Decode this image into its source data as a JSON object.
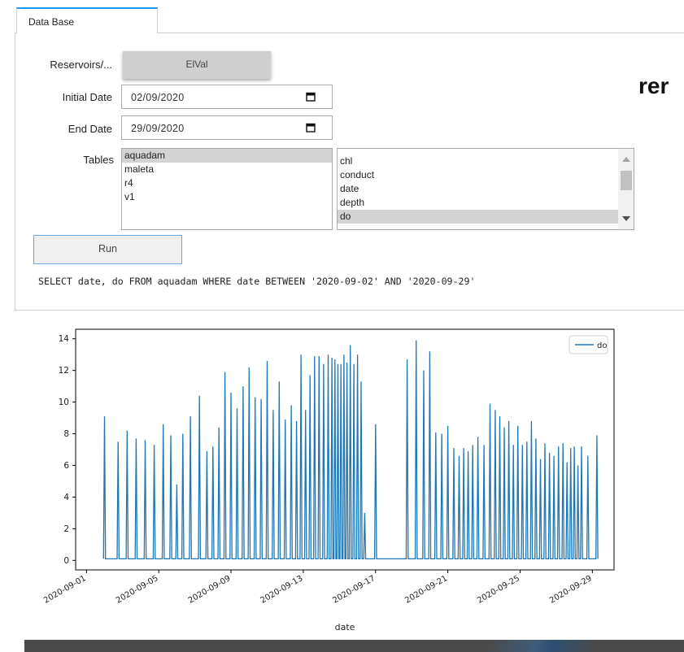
{
  "tab": {
    "label": "Data Base"
  },
  "form": {
    "reservoirs_label": "Reservoirs/...",
    "reservoir_value": "ElVal",
    "initial_date_label": "Initial Date",
    "initial_date_value": "02/09/2020",
    "end_date_label": "End Date",
    "end_date_value": "29/09/2020",
    "tables_label": "Tables",
    "tables": [
      "aquadam",
      "maleta",
      "r4",
      "v1"
    ],
    "tables_selected": "aquadam",
    "columns": [
      "chl",
      "conduct",
      "date",
      "depth",
      "do"
    ],
    "columns_selected": "do",
    "run_label": "Run",
    "sql": "SELECT date, do FROM aquadam WHERE date BETWEEN '2020-09-02' AND '2020-09-29'"
  },
  "overlay_text": "rer",
  "colors": {
    "accent": "#2196f3",
    "series": "#1f77b4"
  },
  "chart_data": {
    "type": "line",
    "title": "",
    "xlabel": "date",
    "ylabel": "",
    "ylim": [
      -0.6,
      14.6
    ],
    "xlim": [
      "2020-09-01",
      "2020-09-30"
    ],
    "yticks": [
      0,
      2,
      4,
      6,
      8,
      10,
      12,
      14
    ],
    "xticks": [
      "2020-09-01",
      "2020-09-05",
      "2020-09-09",
      "2020-09-13",
      "2020-09-17",
      "2020-09-21",
      "2020-09-25",
      "2020-09-29"
    ],
    "legend": "top-right",
    "series": [
      {
        "name": "do",
        "peaks": [
          [
            "2020-09-02",
            9.1
          ],
          [
            "2020-09-03",
            7.5
          ],
          [
            "2020-09-03",
            8.2
          ],
          [
            "2020-09-04",
            7.7
          ],
          [
            "2020-09-04",
            7.6
          ],
          [
            "2020-09-05",
            7.3
          ],
          [
            "2020-09-05",
            8.6
          ],
          [
            "2020-09-06",
            7.9
          ],
          [
            "2020-09-06",
            4.8
          ],
          [
            "2020-09-06",
            8.0
          ],
          [
            "2020-09-07",
            9.1
          ],
          [
            "2020-09-07",
            10.4
          ],
          [
            "2020-09-08",
            6.9
          ],
          [
            "2020-09-08",
            7.2
          ],
          [
            "2020-09-08",
            8.4
          ],
          [
            "2020-09-09",
            11.9
          ],
          [
            "2020-09-09",
            10.6
          ],
          [
            "2020-09-09",
            9.6
          ],
          [
            "2020-09-10",
            11.0
          ],
          [
            "2020-09-10",
            12.2
          ],
          [
            "2020-09-10",
            10.3
          ],
          [
            "2020-09-11",
            10.2
          ],
          [
            "2020-09-11",
            12.6
          ],
          [
            "2020-09-11",
            9.5
          ],
          [
            "2020-09-12",
            11.3
          ],
          [
            "2020-09-12",
            8.9
          ],
          [
            "2020-09-12",
            9.8
          ],
          [
            "2020-09-13",
            8.8
          ],
          [
            "2020-09-13",
            13.0
          ],
          [
            "2020-09-13",
            9.5
          ],
          [
            "2020-09-13",
            11.7
          ],
          [
            "2020-09-14",
            12.9
          ],
          [
            "2020-09-14",
            12.9
          ],
          [
            "2020-09-14",
            12.4
          ],
          [
            "2020-09-14",
            13.0
          ],
          [
            "2020-09-15",
            12.8
          ],
          [
            "2020-09-15",
            12.7
          ],
          [
            "2020-09-15",
            12.4
          ],
          [
            "2020-09-15",
            12.4
          ],
          [
            "2020-09-15",
            13.0
          ],
          [
            "2020-09-15",
            12.5
          ],
          [
            "2020-09-16",
            13.6
          ],
          [
            "2020-09-16",
            12.4
          ],
          [
            "2020-09-16",
            13.0
          ],
          [
            "2020-09-16",
            11.3
          ],
          [
            "2020-09-16",
            3.0
          ],
          [
            "2020-09-17",
            8.6
          ],
          [
            "2020-09-19",
            12.7
          ],
          [
            "2020-09-19",
            13.9
          ],
          [
            "2020-09-20",
            12.0
          ],
          [
            "2020-09-20",
            13.2
          ],
          [
            "2020-09-20",
            8.1
          ],
          [
            "2020-09-21",
            8.0
          ],
          [
            "2020-09-21",
            8.5
          ],
          [
            "2020-09-21",
            7.1
          ],
          [
            "2020-09-22",
            6.6
          ],
          [
            "2020-09-22",
            7.1
          ],
          [
            "2020-09-22",
            6.9
          ],
          [
            "2020-09-22",
            7.3
          ],
          [
            "2020-09-23",
            7.8
          ],
          [
            "2020-09-23",
            7.3
          ],
          [
            "2020-09-23",
            9.9
          ],
          [
            "2020-09-24",
            9.5
          ],
          [
            "2020-09-24",
            9.1
          ],
          [
            "2020-09-24",
            8.4
          ],
          [
            "2020-09-24",
            8.8
          ],
          [
            "2020-09-25",
            7.3
          ],
          [
            "2020-09-25",
            8.5
          ],
          [
            "2020-09-25",
            7.3
          ],
          [
            "2020-09-25",
            7.5
          ],
          [
            "2020-09-26",
            8.8
          ],
          [
            "2020-09-26",
            7.7
          ],
          [
            "2020-09-26",
            6.4
          ],
          [
            "2020-09-26",
            7.4
          ],
          [
            "2020-09-27",
            6.8
          ],
          [
            "2020-09-27",
            6.6
          ],
          [
            "2020-09-27",
            7.2
          ],
          [
            "2020-09-27",
            7.4
          ],
          [
            "2020-09-28",
            6.2
          ],
          [
            "2020-09-28",
            7.1
          ],
          [
            "2020-09-28",
            7.2
          ],
          [
            "2020-09-28",
            6.0
          ],
          [
            "2020-09-28",
            7.2
          ],
          [
            "2020-09-29",
            6.6
          ],
          [
            "2020-09-29",
            7.9
          ]
        ],
        "baseline": 0.1
      }
    ]
  }
}
